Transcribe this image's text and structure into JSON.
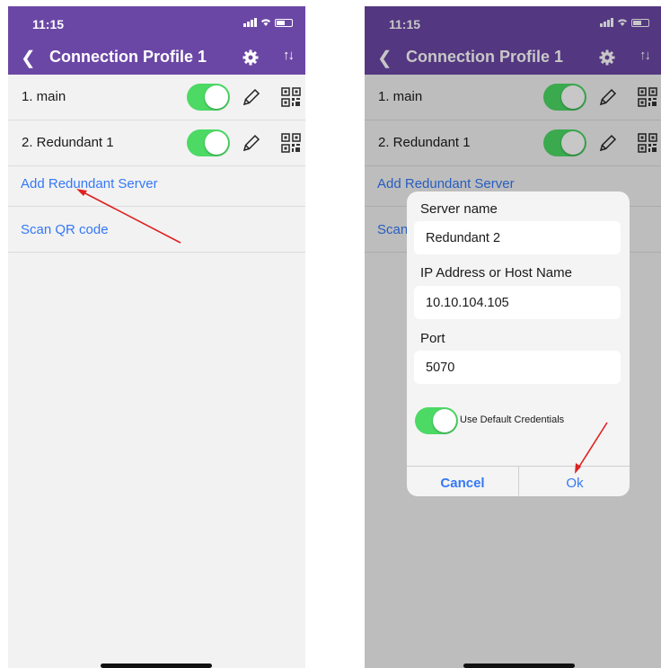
{
  "colors": {
    "header": "#6b47a5",
    "toggle_on": "#4cd964",
    "link": "#3478f6",
    "annotation_arrow": "#e02020"
  },
  "left_screen": {
    "status": {
      "time": "11:15"
    },
    "header": {
      "back_icon": "chevron-left-icon",
      "title": "Connection Profile 1",
      "settings_icon": "gear-icon",
      "sort_icon": "sort-icon"
    },
    "servers": [
      {
        "label": "1. main",
        "enabled": true
      },
      {
        "label": "2. Redundant 1",
        "enabled": true
      }
    ],
    "add_server_label": "Add Redundant Server",
    "scan_qr_label": "Scan QR code"
  },
  "right_screen": {
    "status": {
      "time": "11:15"
    },
    "header": {
      "back_icon": "chevron-left-icon",
      "title": "Connection Profile 1",
      "settings_icon": "gear-icon",
      "sort_icon": "sort-icon"
    },
    "servers": [
      {
        "label": "1. main",
        "enabled": true
      },
      {
        "label": "2. Redundant 1",
        "enabled": true
      }
    ],
    "add_server_label": "Add Redundant Server",
    "scan_qr_label_visible": "Scan",
    "dialog": {
      "server_name_label": "Server name",
      "server_name_value": "Redundant 2",
      "host_label": "IP Address or Host Name",
      "host_value": "10.10.104.105",
      "port_label": "Port",
      "port_value": "5070",
      "default_credentials_label": "Use Default Credentials",
      "default_credentials_on": true,
      "cancel_label": "Cancel",
      "ok_label": "Ok"
    }
  }
}
